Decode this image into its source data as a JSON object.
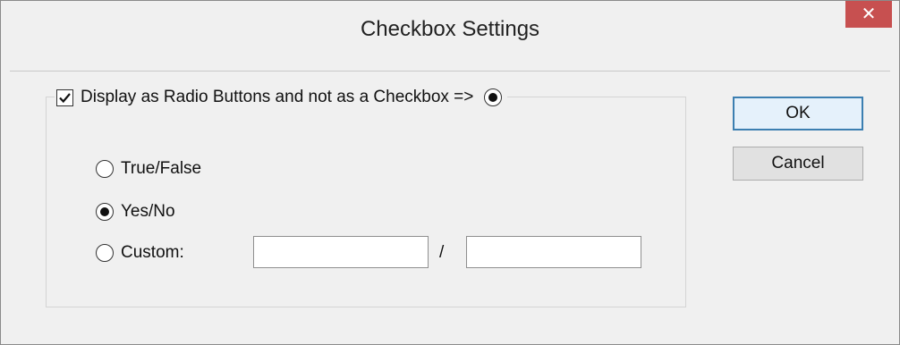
{
  "window": {
    "title": "Checkbox Settings",
    "close_glyph": "✕"
  },
  "group": {
    "checkbox_checked": true,
    "legend_label": "Display as Radio Buttons and not as a Checkbox =>",
    "legend_radio_selected": true
  },
  "options": [
    {
      "label": "True/False",
      "selected": false
    },
    {
      "label": "Yes/No",
      "selected": true
    },
    {
      "label": "Custom:",
      "selected": false
    }
  ],
  "custom": {
    "true_value": "",
    "false_value": "",
    "separator": "/"
  },
  "buttons": {
    "ok_label": "OK",
    "cancel_label": "Cancel"
  },
  "colors": {
    "close_button": "#c75050",
    "default_button_border": "#3c7fb1"
  }
}
